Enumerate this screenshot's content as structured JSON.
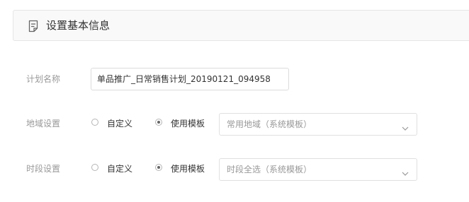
{
  "header": {
    "icon": "document-icon",
    "title": "设置基本信息"
  },
  "plan_name": {
    "label": "计划名称",
    "value": "单品推广_日常销售计划_20190121_094958"
  },
  "region": {
    "label": "地域设置",
    "option_custom": "自定义",
    "option_template": "使用模板",
    "selected": "使用模板",
    "select_value": "常用地域（系统模板）"
  },
  "time_period": {
    "label": "时段设置",
    "option_custom": "自定义",
    "option_template": "使用模板",
    "selected": "使用模板",
    "select_value": "时段全选（系统模板）"
  },
  "colors": {
    "header_bg": "#f9f9f9",
    "label_text": "#999999",
    "border": "#dcdcdc"
  }
}
